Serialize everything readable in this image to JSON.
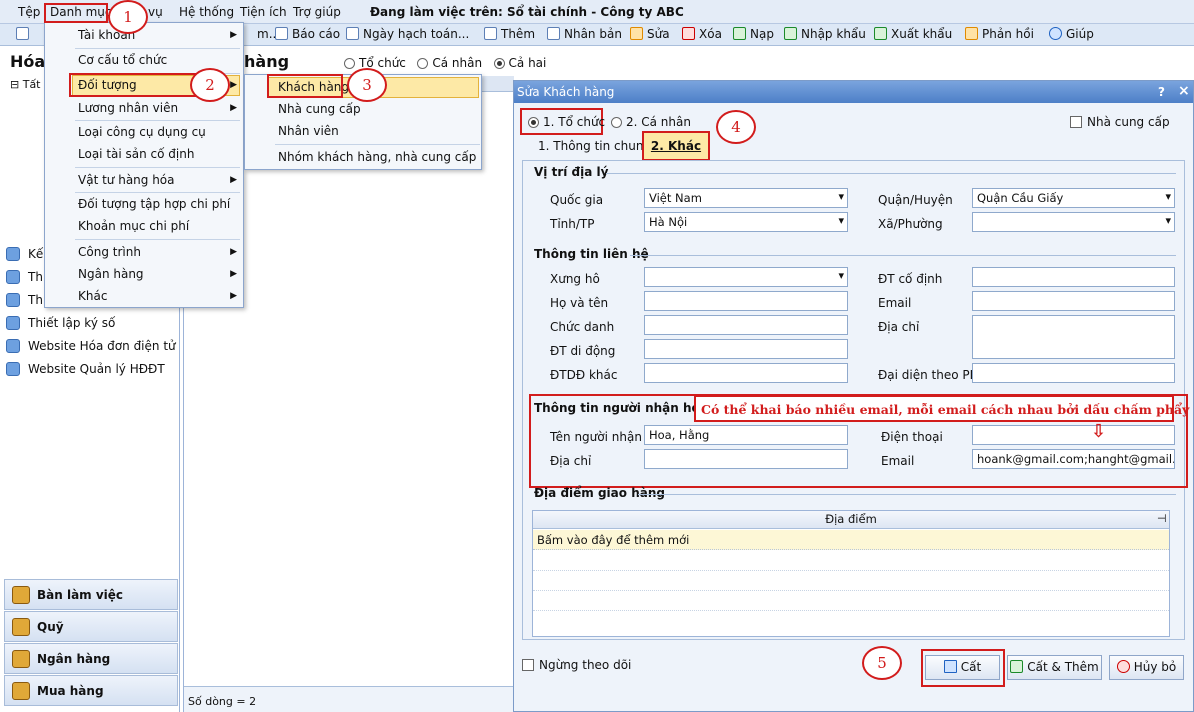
{
  "menu": {
    "items": [
      "Tệp",
      "Danh mục",
      "vụ",
      "Hệ thống",
      "Tiện ích",
      "Trợ giúp"
    ],
    "status": "Đang làm việc trên: Sổ tài chính - Công ty ABC"
  },
  "toolbar": {
    "left": [
      "m...",
      "Báo cáo",
      "Ngày hạch toán..."
    ],
    "right": [
      "Thêm",
      "Nhân bản",
      "Sửa",
      "Xóa",
      "Nạp",
      "Nhập khẩu",
      "Xuất khẩu",
      "Phản hồi",
      "Giúp"
    ]
  },
  "left_panel": {
    "title": "Hóa",
    "tree_item": "Tất",
    "nav": [
      "Kế",
      "Th",
      "Th",
      "Thiết lập ký số",
      "Website Hóa đơn điện tử",
      "Website Quản lý HĐĐT"
    ],
    "bottom": [
      "Bàn làm việc",
      "Quỹ",
      "Ngân hàng",
      "Mua hàng"
    ]
  },
  "center": {
    "title": "hàng",
    "radios": [
      "Tổ chức",
      "Cá nhân",
      "Cả hai"
    ],
    "footer": "Số dòng = 2"
  },
  "dropdown_menu": {
    "items": [
      "Tài khoản",
      "Cơ cấu tổ chức",
      "Đối tượng",
      "Lương nhân viên",
      "Loại công cụ dụng cụ",
      "Loại tài sản cố định",
      "Vật tư hàng hóa",
      "Đối tượng tập hợp chi phí",
      "Khoản mục chi phí",
      "Công trình",
      "Ngân hàng",
      "Khác"
    ]
  },
  "submenu": {
    "items": [
      "Khách hàng",
      "Nhà cung cấp",
      "Nhân viên",
      "Nhóm khách hàng, nhà cung cấp"
    ]
  },
  "steps": [
    "1",
    "2",
    "3",
    "4",
    "5"
  ],
  "dialog": {
    "title": "Sửa Khách hàng",
    "help": "?",
    "close": "×",
    "type_org": "1. Tổ chức",
    "type_person": "2. Cá nhân",
    "supplier_check": "Nhà cung cấp",
    "tab_general": "1. Thông tin chung",
    "tab_other": "2. Khác",
    "geo": {
      "section": "Vị trí địa lý",
      "country_label": "Quốc gia",
      "country": "Việt Nam",
      "province_label": "Tỉnh/TP",
      "province": "Hà Nội",
      "district_label": "Quận/Huyện",
      "district": "Quận Cầu Giấy",
      "ward_label": "Xã/Phường",
      "ward": ""
    },
    "contact": {
      "section": "Thông tin liên hệ",
      "title_label": "Xưng hô",
      "name_label": "Họ và tên",
      "position_label": "Chức danh",
      "mobile_label": "ĐT di động",
      "other_phone_label": "ĐTDĐ khác",
      "landline_label": "ĐT cố định",
      "email_label": "Email",
      "address_label": "Địa chỉ",
      "legal_rep_label": "Đại diện theo PL"
    },
    "invoice": {
      "section": "Thông tin người nhận hóa đơn",
      "note": "Có thể khai báo nhiều email, mỗi email cách nhau bởi dấu chấm phẩy (;)",
      "receiver_label": "Tên người nhận",
      "receiver": "Hoa, Hằng",
      "address_label": "Địa chỉ",
      "address": "",
      "phone_label": "Điện thoại",
      "phone": "",
      "email_label": "Email",
      "email": "hoank@gmail.com;hanght@gmail.com"
    },
    "delivery": {
      "section": "Địa điểm giao hàng",
      "column": "Địa điểm",
      "add_row": "Bấm vào đây để thêm mới"
    },
    "stop_tracking": "Ngừng theo dõi",
    "buttons": {
      "save": "Cất",
      "save_add": "Cất & Thêm",
      "cancel": "Hủy bỏ"
    }
  }
}
